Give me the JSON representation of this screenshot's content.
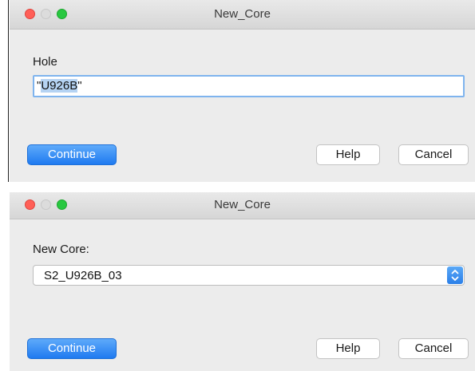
{
  "dialogs": [
    {
      "title": "New_Core",
      "field_label": "Hole",
      "input": {
        "value_prefix": "\"",
        "value_selected": "U926B",
        "value_suffix": "\""
      },
      "buttons": {
        "continue": "Continue",
        "help": "Help",
        "cancel": "Cancel"
      }
    },
    {
      "title": "New_Core",
      "field_label": "New Core:",
      "select": {
        "value": "S2_U926B_03"
      },
      "buttons": {
        "continue": "Continue",
        "help": "Help",
        "cancel": "Cancel"
      }
    }
  ],
  "colors": {
    "close": "#ff5f57",
    "minimize_inactive": "#dcdcdc",
    "zoom": "#28c840",
    "primary_button": "#1f7af0",
    "focus_ring": "#7fb4ee",
    "text_selection": "#b5d3f3"
  },
  "icons": {
    "window_controls": [
      "close-icon",
      "minimize-icon",
      "zoom-icon"
    ],
    "select_indicator": "up-down-chevron-icon"
  }
}
